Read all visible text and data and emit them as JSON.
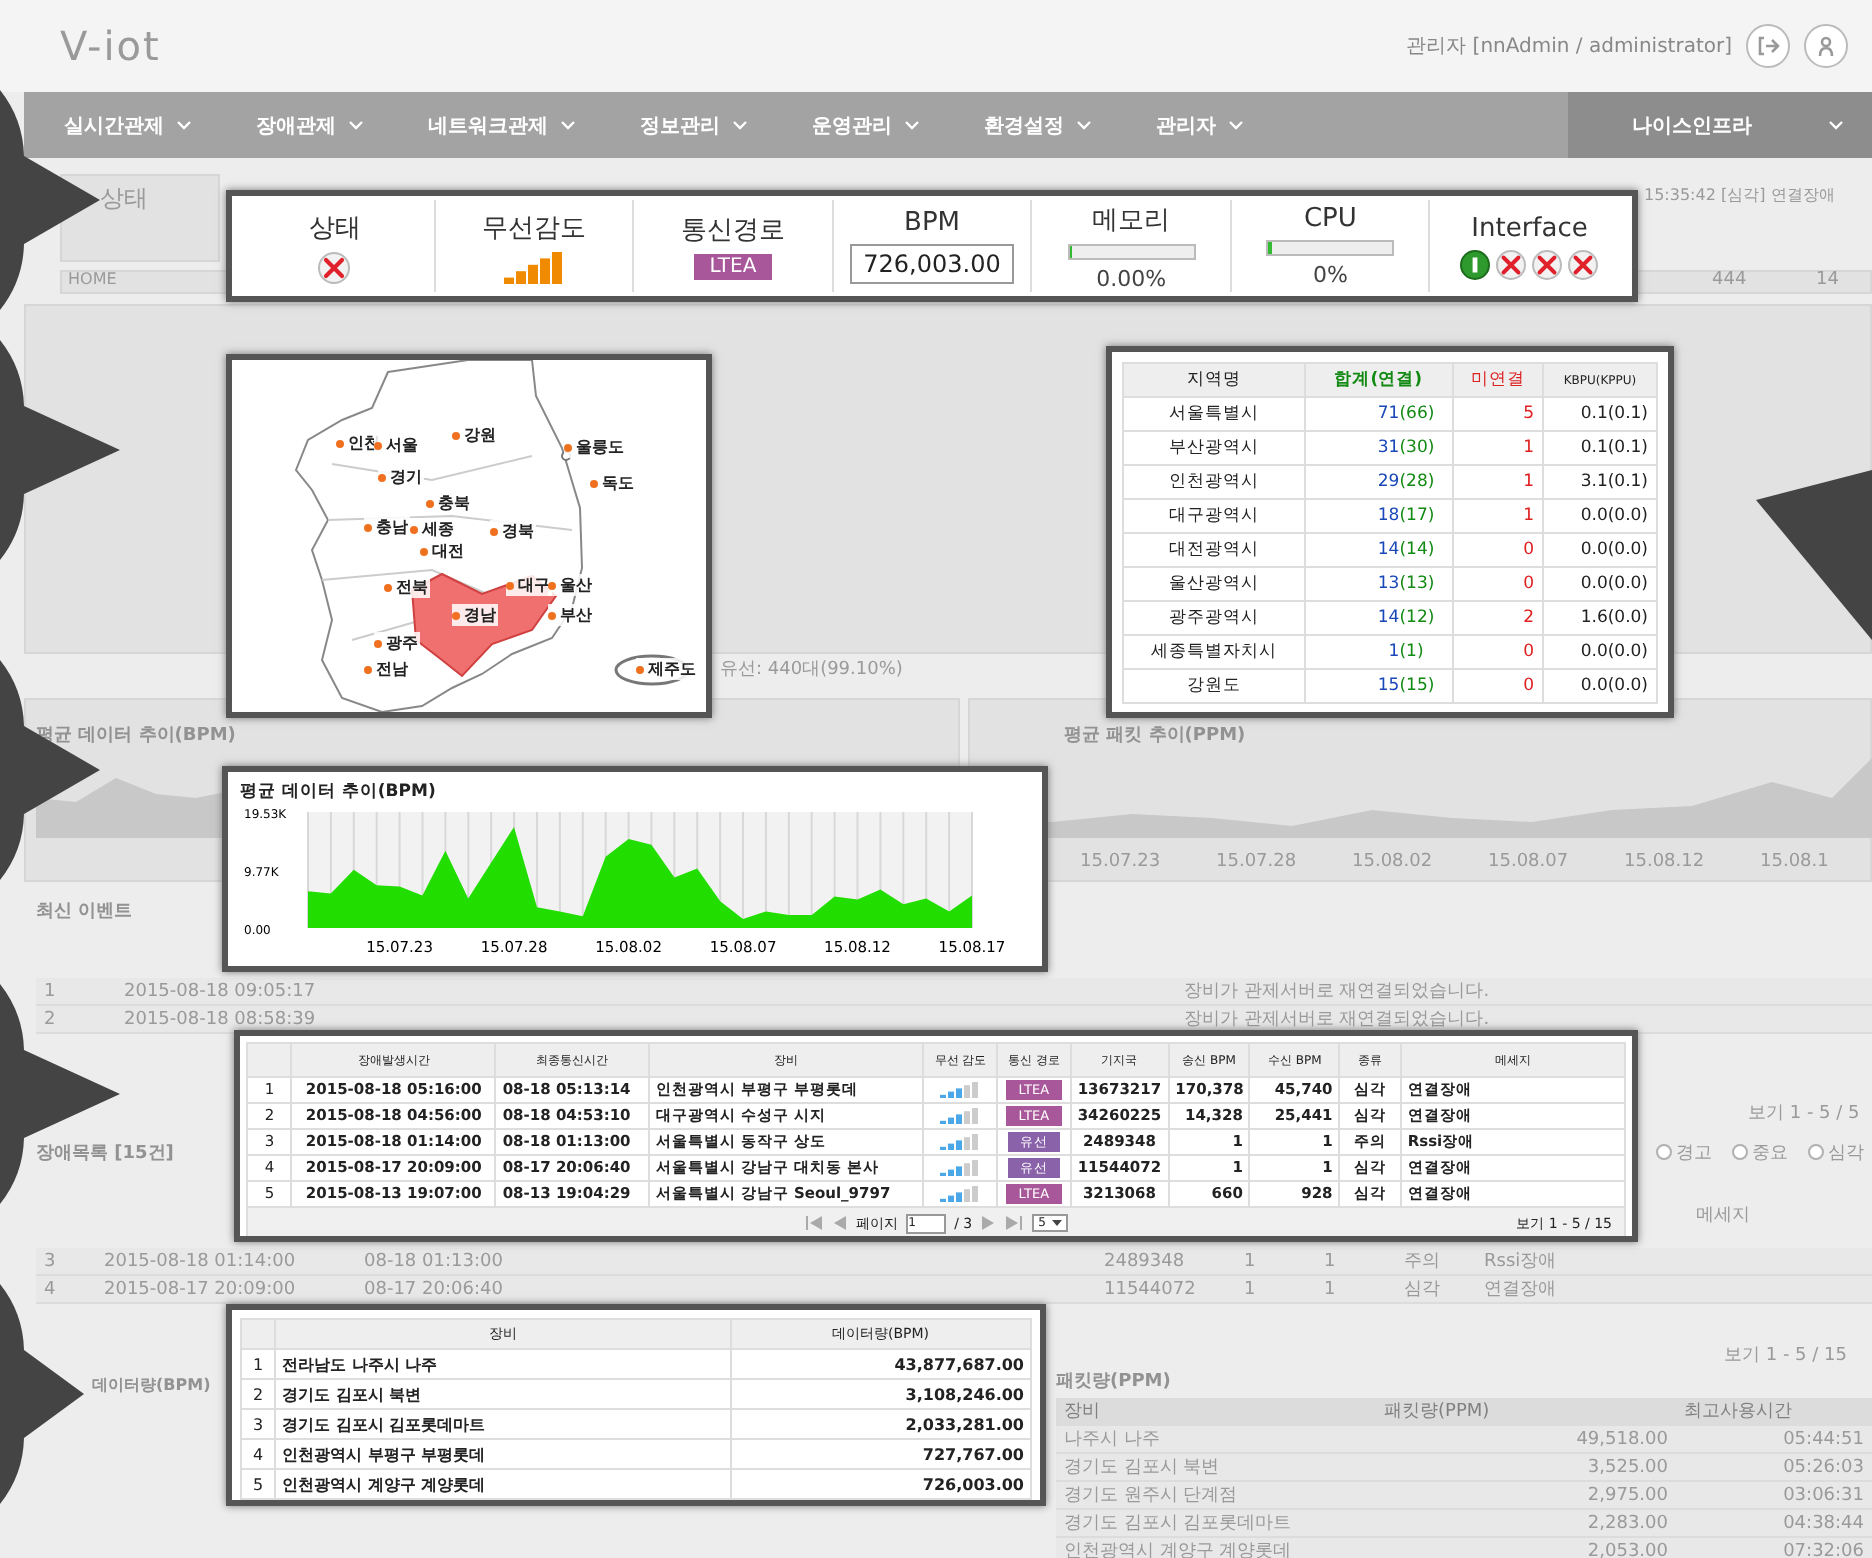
{
  "header": {
    "logo": "V-iot",
    "user": "관리자 [nnAdmin / administrator]"
  },
  "nav": {
    "items": [
      "실시간관제",
      "장애관제",
      "네트워크관제",
      "정보관리",
      "운영관리",
      "환경설정",
      "관리자"
    ],
    "org": "나이스인프라"
  },
  "background": {
    "status_label": "상태",
    "breadcrumb": "HOME",
    "latest_alert": "15:35:42 [심각] 연결장애",
    "counts": [
      "444",
      "14"
    ],
    "wired_stat": "유선: 440대(99.10%)",
    "chart_titles": [
      "평균 데이터 추이(BPM)",
      "평균 패킷 추이(PPM)"
    ],
    "ppm_dates": [
      "15.07.23",
      "15.07.28",
      "15.08.02",
      "15.08.07",
      "15.08.12",
      "15.08.1"
    ],
    "events_title": "최신 이벤트",
    "events": [
      {
        "no": "1",
        "time": "2015-08-18 09:05:17",
        "message": "장비가 관제서버로 재연결되었습니다."
      },
      {
        "no": "2",
        "time": "2015-08-18 08:58:39",
        "message": "장비가 관제서버로 재연결되었습니다."
      }
    ],
    "events_pager": "보기 1 - 5 / 5",
    "faults_title": "장애목록 [15건]",
    "fault_filters": [
      {
        "label": "경고",
        "checked": false
      },
      {
        "label": "중요",
        "checked": false
      },
      {
        "label": "심각",
        "checked": false
      }
    ],
    "faults_message_header": "메세지",
    "faults": [
      {
        "no": "3",
        "time": "2015-08-18 01:14:00",
        "last": "08-18 01:13:00",
        "station": "2489348",
        "tx": "1",
        "rx": "1",
        "type": "주의",
        "message": "Rssi장애"
      },
      {
        "no": "4",
        "time": "2015-08-17 20:09:00",
        "last": "08-17 20:06:40",
        "station": "11544072",
        "tx": "1",
        "rx": "1",
        "type": "심각",
        "message": "연결장애"
      }
    ],
    "faults_pager": "보기 1 - 5 / 15",
    "data_title": "데이터량(BPM)",
    "packet_title": "패킷량(PPM)",
    "packet_columns": [
      "장비",
      "패킷량(PPM)",
      "최고사용시간"
    ],
    "packets": [
      [
        "나주시 나주",
        "49,518.00",
        "05:44:51"
      ],
      [
        "경기도 김포시 북변",
        "3,525.00",
        "05:26:03"
      ],
      [
        "경기도 원주시 단계점",
        "2,975.00",
        "03:06:31"
      ],
      [
        "경기도 김포시 김포롯데마트",
        "2,283.00",
        "04:38:44"
      ],
      [
        "인천광역시 계양구 계양롯데",
        "2,053.00",
        "07:32:06"
      ]
    ]
  },
  "status": {
    "state": {
      "label": "상태",
      "kind": "error"
    },
    "signal": {
      "label": "무선감도"
    },
    "path": {
      "label": "통신경로",
      "value": "LTEA"
    },
    "bpm": {
      "label": "BPM",
      "value": "726,003.00"
    },
    "memory": {
      "label": "메모리",
      "level": 0.03,
      "reading": "0.00%"
    },
    "cpu": {
      "label": "CPU",
      "level": 0.03,
      "reading": "0%"
    },
    "interface": {
      "label": "Interface",
      "ports": [
        {
          "kind": "ok"
        },
        {
          "kind": "error"
        },
        {
          "kind": "error"
        },
        {
          "kind": "error"
        }
      ]
    }
  },
  "map": {
    "regions": [
      {
        "name": "인천"
      },
      {
        "name": "서울"
      },
      {
        "name": "강원"
      },
      {
        "name": "울릉도"
      },
      {
        "name": "독도"
      },
      {
        "name": "경기"
      },
      {
        "name": "충북"
      },
      {
        "name": "충남"
      },
      {
        "name": "세종"
      },
      {
        "name": "대전"
      },
      {
        "name": "경북"
      },
      {
        "name": "전북"
      },
      {
        "name": "대구"
      },
      {
        "name": "울산"
      },
      {
        "name": "경남"
      },
      {
        "name": "부산"
      },
      {
        "name": "광주"
      },
      {
        "name": "전남"
      },
      {
        "name": "제주도"
      }
    ]
  },
  "regions_table": {
    "columns": [
      "지역명",
      "합계(연결)",
      "미연결",
      "KBPU(KPPU)"
    ],
    "rows": [
      {
        "region": "서울특별시",
        "total": "71",
        "connected": "(66)",
        "unconnected": "5",
        "traffic": "0.1(0.1)"
      },
      {
        "region": "부산광역시",
        "total": "31",
        "connected": "(30)",
        "unconnected": "1",
        "traffic": "0.1(0.1)"
      },
      {
        "region": "인천광역시",
        "total": "29",
        "connected": "(28)",
        "unconnected": "1",
        "traffic": "3.1(0.1)"
      },
      {
        "region": "대구광역시",
        "total": "18",
        "connected": "(17)",
        "unconnected": "1",
        "traffic": "0.0(0.0)"
      },
      {
        "region": "대전광역시",
        "total": "14",
        "connected": "(14)",
        "unconnected": "0",
        "traffic": "0.0(0.0)"
      },
      {
        "region": "울산광역시",
        "total": "13",
        "connected": "(13)",
        "unconnected": "0",
        "traffic": "0.0(0.0)"
      },
      {
        "region": "광주광역시",
        "total": "14",
        "connected": "(12)",
        "unconnected": "2",
        "traffic": "1.6(0.0)"
      },
      {
        "region": "세종특별자치시",
        "total": "1",
        "connected": "(1)",
        "unconnected": "0",
        "traffic": "0.0(0.0)"
      },
      {
        "region": "강원도",
        "total": "15",
        "connected": "(15)",
        "unconnected": "0",
        "traffic": "0.0(0.0)"
      }
    ]
  },
  "bpm_chart": {
    "title": "평균 데이터 추이(BPM)",
    "chart_data": {
      "type": "area",
      "grid": true,
      "categories": [
        null,
        null,
        null,
        null,
        "15.07.23",
        null,
        null,
        null,
        null,
        "15.07.28",
        null,
        null,
        null,
        null,
        "15.08.02",
        null,
        null,
        null,
        null,
        "15.08.07",
        null,
        null,
        null,
        null,
        "15.08.12",
        null,
        null,
        null,
        null,
        "15.08.17"
      ],
      "series": [
        {
          "color": "#22dd00",
          "values": [
            6.2,
            5.8,
            9.8,
            7.2,
            7.0,
            5.5,
            13.0,
            5.0,
            11.0,
            17.0,
            3.5,
            2.8,
            2.0,
            12.0,
            15.0,
            14.0,
            8.5,
            10.0,
            4.5,
            1.5,
            2.8,
            2.2,
            2.2,
            5.3,
            4.8,
            6.5,
            4.0,
            5.0,
            2.8,
            5.5
          ]
        }
      ],
      "ylim": [
        0,
        19.53
      ],
      "yticks": [
        {
          "value": 0,
          "label": "0.00"
        },
        {
          "value": 9.77,
          "label": "9.77K"
        },
        {
          "value": 19.53,
          "label": "19.53K"
        }
      ]
    }
  },
  "fault_table": {
    "columns": [
      "장애발생시간",
      "최종통신시간",
      "장비",
      "무선 감도",
      "통신 경로",
      "기지국",
      "송신 BPM",
      "수신 BPM",
      "종류",
      "메세지"
    ],
    "rows": [
      {
        "no": "1",
        "time": "2015-08-18 05:16:00",
        "last": "08-18 05:13:14",
        "device": "인천광역시 부평구 부평롯데",
        "path": {
          "label": "LTEA",
          "color": "#a8589a"
        },
        "station": "13673217",
        "tx": "170,378",
        "rx": "45,740",
        "type": "심각",
        "message": "연결장애"
      },
      {
        "no": "2",
        "time": "2015-08-18 04:56:00",
        "last": "08-18 04:53:10",
        "device": "대구광역시 수성구 시지",
        "path": {
          "label": "LTEA",
          "color": "#a8589a"
        },
        "station": "34260225",
        "tx": "14,328",
        "rx": "25,441",
        "type": "심각",
        "message": "연결장애"
      },
      {
        "no": "3",
        "time": "2015-08-18 01:14:00",
        "last": "08-18 01:13:00",
        "device": "서울특별시 동작구 상도",
        "path": {
          "label": "유선",
          "color": "#8a62aa"
        },
        "station": "2489348",
        "tx": "1",
        "rx": "1",
        "type": "주의",
        "message": "Rssi장애"
      },
      {
        "no": "4",
        "time": "2015-08-17 20:09:00",
        "last": "08-17 20:06:40",
        "device": "서울특별시 강남구 대치동 본사",
        "path": {
          "label": "유선",
          "color": "#8a62aa"
        },
        "station": "11544072",
        "tx": "1",
        "rx": "1",
        "type": "심각",
        "message": "연결장애"
      },
      {
        "no": "5",
        "time": "2015-08-13 19:07:00",
        "last": "08-13 19:04:29",
        "device": "서울특별시 강남구 Seoul_9797",
        "path": {
          "label": "LTEA",
          "color": "#a8589a"
        },
        "station": "3213068",
        "tx": "660",
        "rx": "928",
        "type": "심각",
        "message": "연결장애"
      }
    ],
    "pager": {
      "label": "페이지",
      "page": "1",
      "total": "/ 3",
      "size": "5",
      "summary": "보기 1 - 5 / 15"
    }
  },
  "data_table": {
    "columns": [
      "",
      "장비",
      "데이터량(BPM)"
    ],
    "rows": [
      [
        "1",
        "전라남도 나주시 나주",
        "43,877,687.00"
      ],
      [
        "2",
        "경기도 김포시 북변",
        "3,108,246.00"
      ],
      [
        "3",
        "경기도 김포시 김포롯데마트",
        "2,033,281.00"
      ],
      [
        "4",
        "인천광역시 부평구 부평롯데",
        "727,767.00"
      ],
      [
        "5",
        "인천광역시 계양구 계양롯데",
        "726,003.00"
      ]
    ]
  }
}
